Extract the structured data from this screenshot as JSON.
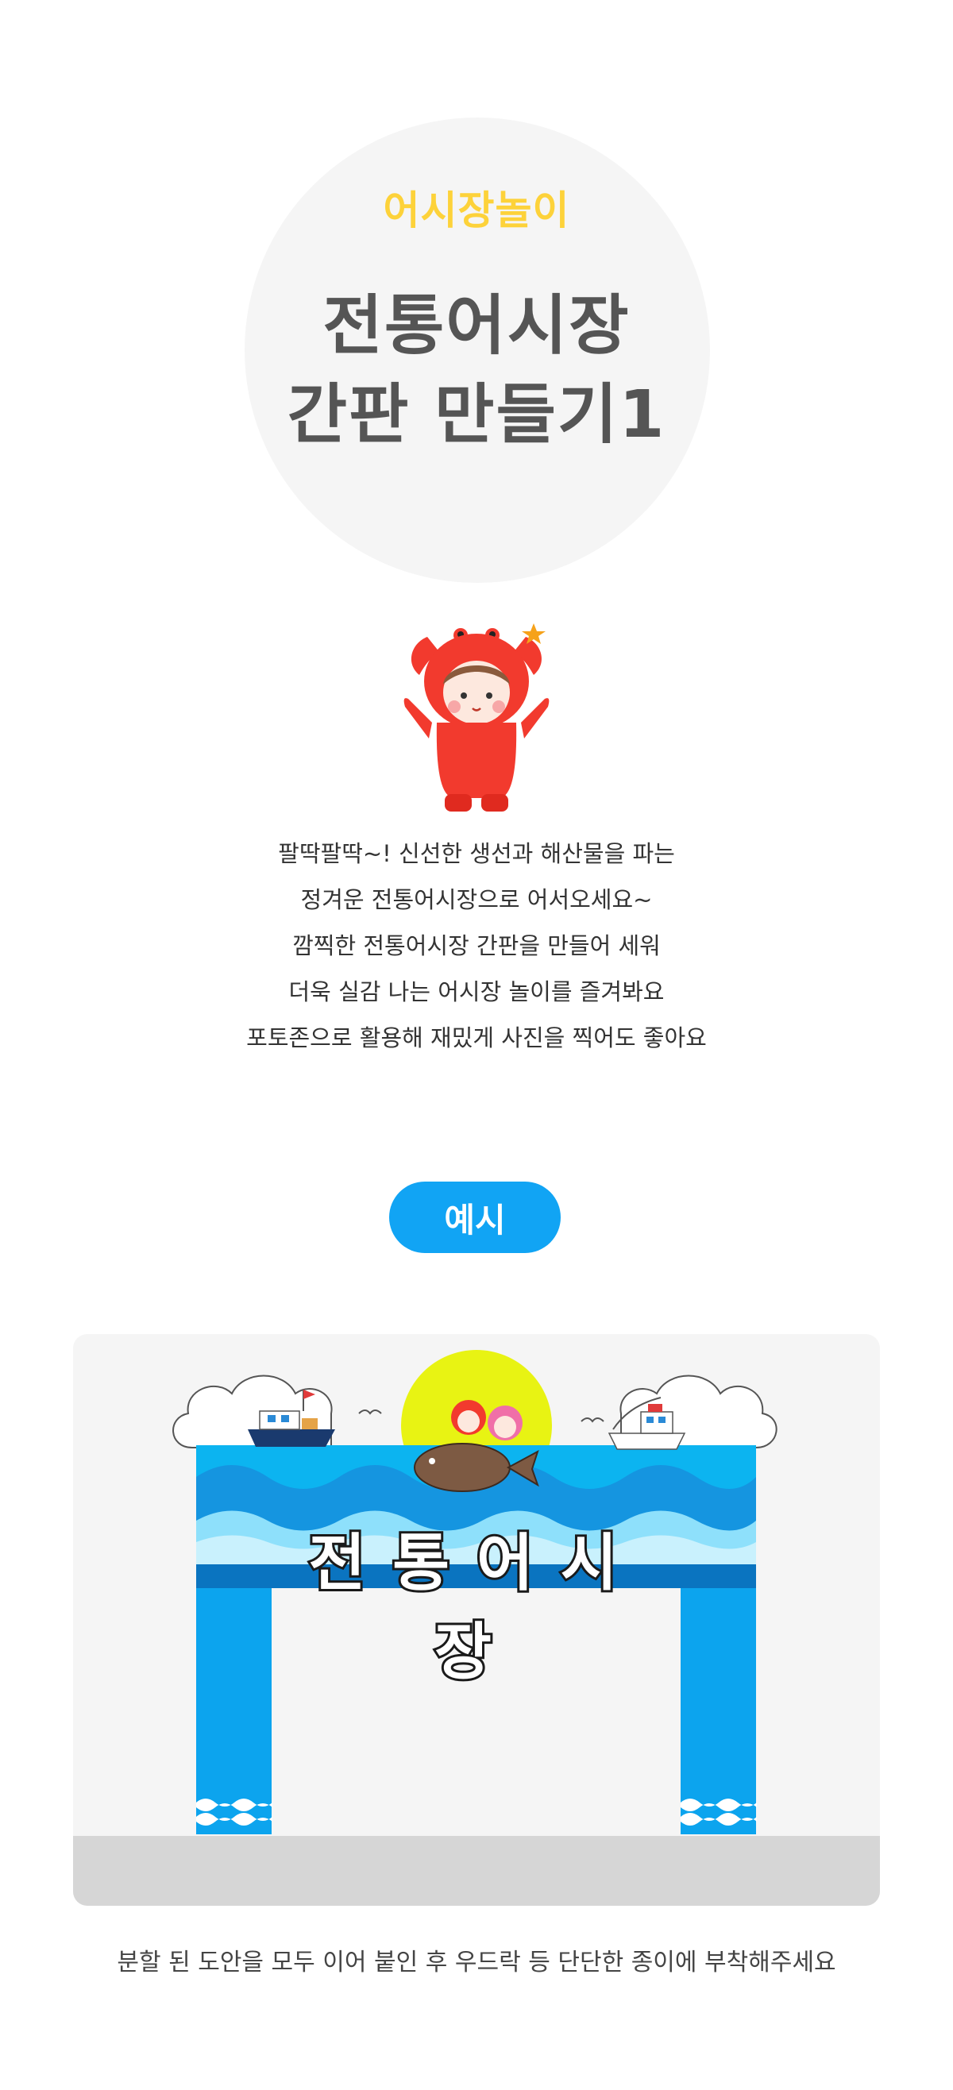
{
  "header": {
    "subtitle": "어시장놀이",
    "title_line1": "전통어시장",
    "title_line2": "간판 만들기1"
  },
  "description": [
    "팔딱팔딱~! 신선한 생선과 해산물을 파는",
    "정겨운 전통어시장으로 어서오세요~",
    "깜찍한 전통어시장 간판을 만들어 세워",
    "더욱 실감 나는 어시장 놀이를 즐겨봐요",
    "포토존으로 활용해 재밌게 사진을 찍어도 좋아요"
  ],
  "example": {
    "badge": "예시",
    "sign_text": "전통어시장"
  },
  "caption": "분할 된 도안을 모두 이어 붙인 후 우드락 등 단단한 종이에 부착해주세요",
  "colors": {
    "accent_blue": "#11a4f4",
    "subtitle_yellow": "#fdd23a",
    "title_gray": "#555555"
  },
  "icons": [
    "crab-mascot-icon",
    "boat-icon",
    "fish-icon",
    "seagull-icon",
    "wave-icon"
  ]
}
